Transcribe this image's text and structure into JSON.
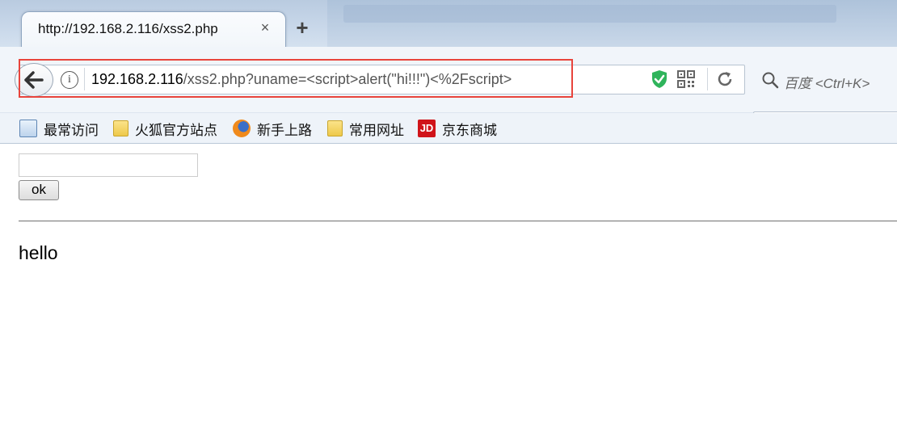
{
  "tab": {
    "title": "http://192.168.2.116/xss2.php",
    "close_label": "×",
    "new_tab_label": "+"
  },
  "urlbar": {
    "host": "192.168.2.116",
    "path": "/xss2.php?uname=<script>alert(\"hi!!!\")<%2Fscript>",
    "info_label": "i"
  },
  "search": {
    "placeholder": "百度 <Ctrl+K>"
  },
  "bookmarks": [
    {
      "label": "最常访问",
      "icon": "most-visited-icon"
    },
    {
      "label": "火狐官方站点",
      "icon": "folder-icon"
    },
    {
      "label": "新手上路",
      "icon": "firefox-icon"
    },
    {
      "label": "常用网址",
      "icon": "folder-icon"
    },
    {
      "label": "京东商城",
      "icon": "jd-icon",
      "icon_text": "JD"
    }
  ],
  "page": {
    "input_value": "",
    "ok_label": "ok",
    "output_text": "hello"
  },
  "colors": {
    "highlight": "#e8443c",
    "shield": "#2fb45b",
    "jd": "#d0141a"
  }
}
